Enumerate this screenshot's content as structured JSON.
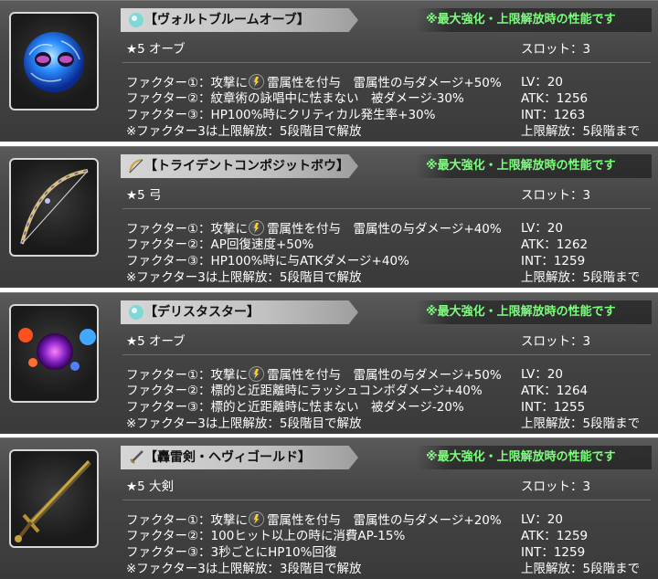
{
  "note_text": "※最大強化・上限解放時の性能です",
  "slot_label": "スロット：3",
  "cards": [
    {
      "name": "【ヴォルトブルームオーブ】",
      "rarity": "★5 オーブ",
      "f1_pre": "ファクター①：攻撃に",
      "f1_post": "雷属性を付与　雷属性の与ダメージ+50%",
      "f2": "ファクター②：紋章術の詠唱中に怯まない　被ダメージ-30%",
      "f3": "ファクター③：HP100%時にクリティカル発生率+30%",
      "f4": "※ファクター3は上限解放：5段階目で解放",
      "lv": "LV：20",
      "atk": "ATK：1256",
      "int": "INT：1263",
      "limit": "上限解放：5段階まで",
      "icon": "orb-icon"
    },
    {
      "name": "【トライデントコンポジットボウ】",
      "rarity": "★5 弓",
      "f1_pre": "ファクター①：攻撃に",
      "f1_post": "雷属性を付与　雷属性の与ダメージ+40%",
      "f2": "ファクター②：AP回復速度+50%",
      "f3": "ファクター③：HP100%時に与ATKダメージ+40%",
      "f4": "※ファクター3は上限解放：5段階目で解放",
      "lv": "LV：20",
      "atk": "ATK：1262",
      "int": "INT：1259",
      "limit": "上限解放：5段階まで",
      "icon": "bow-icon"
    },
    {
      "name": "【デリスタスター】",
      "rarity": "★5 オーブ",
      "f1_pre": "ファクター①：攻撃に",
      "f1_post": "雷属性を付与　雷属性の与ダメージ+50%",
      "f2": "ファクター②：標的と近距離時にラッシュコンボダメージ+40%",
      "f3": "ファクター③：標的と近距離時に怯まない　被ダメージ-20%",
      "f4": "※ファクター3は上限解放：5段階目で解放",
      "lv": "LV：20",
      "atk": "ATK：1264",
      "int": "INT：1255",
      "limit": "上限解放：5段階まで",
      "icon": "orb-icon"
    },
    {
      "name": "【轟雷剣・ヘヴィゴールド】",
      "rarity": "★5 大剣",
      "f1_pre": "ファクター①：攻撃に",
      "f1_post": "雷属性を付与　雷属性の与ダメージ+20%",
      "f2": "ファクター②：100ヒット以上の時に消費AP-15%",
      "f3": "ファクター③：3秒ごとにHP10%回復",
      "f4": "※ファクター3は上限解放：3段階目で解放",
      "lv": "LV：20",
      "atk": "ATK：1259",
      "int": "INT：1259",
      "limit": "上限解放：5段階まで",
      "icon": "sword-icon"
    }
  ]
}
